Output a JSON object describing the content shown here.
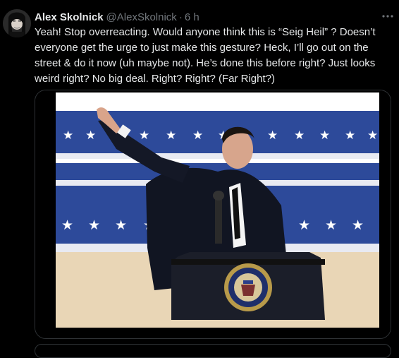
{
  "tweet": {
    "author": {
      "display_name": "Alex Skolnick",
      "handle": "@AlexSkolnick",
      "avatar_icon": "profile-photo"
    },
    "separator": "·",
    "timestamp": "6 h",
    "text": "Yeah! Stop overreacting. Would anyone think this is “Seig Heil” ? Doesn’t everyone get the urge to just make this gesture? Heck, I’ll go out on the street & do it now (uh maybe not). He’s done this before right? Just looks weird right? No big deal. Right? Right? (Far Right?)",
    "more_icon": "ellipsis-icon",
    "media": {
      "type": "photo"
    }
  },
  "colors": {
    "background": "#000000",
    "text_primary": "#e7e9ea",
    "text_secondary": "#71767b",
    "border": "#2f3336",
    "banner_blue": "#2d4a9a"
  }
}
